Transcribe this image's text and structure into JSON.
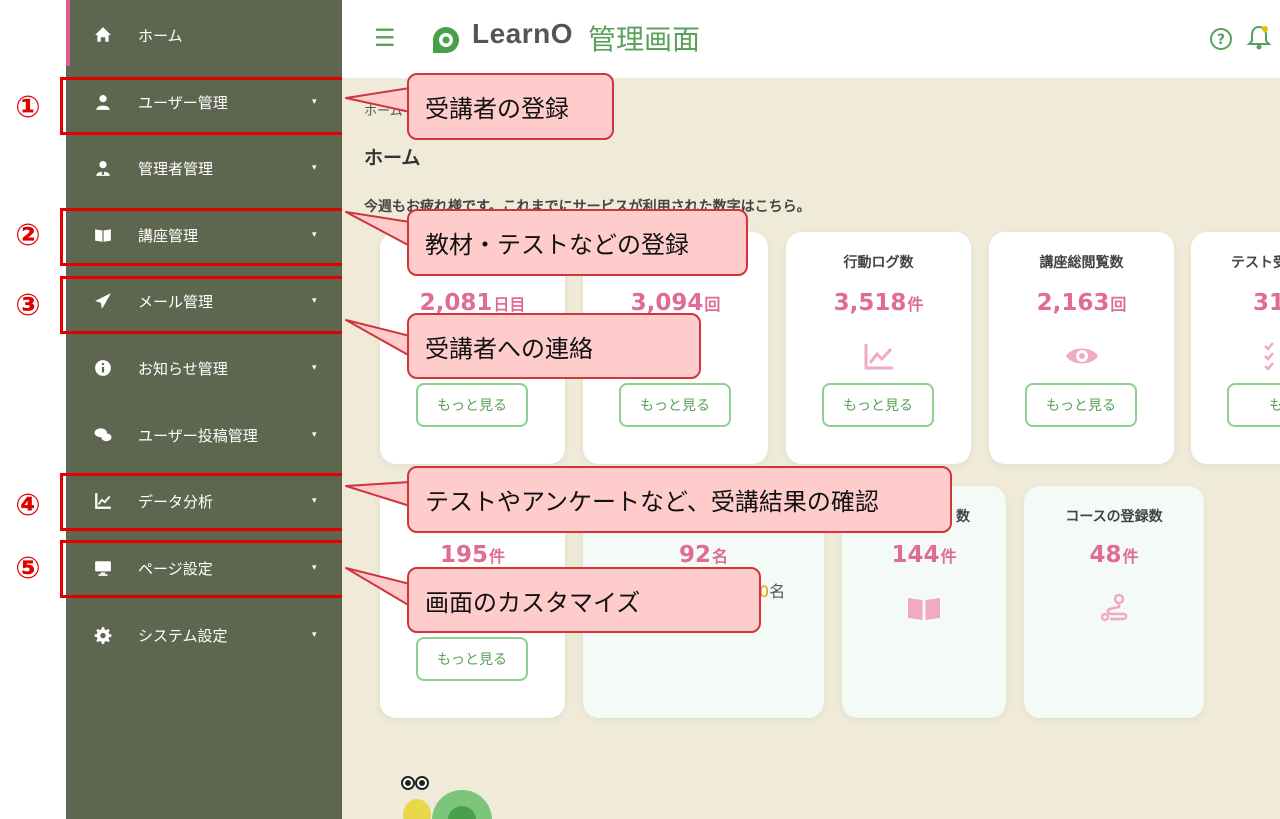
{
  "markers": [
    "①",
    "②",
    "③",
    "④",
    "⑤"
  ],
  "sidebar": {
    "items": [
      {
        "label": "ホーム",
        "icon": "home-icon"
      },
      {
        "label": "ユーザー管理",
        "icon": "user-icon"
      },
      {
        "label": "管理者管理",
        "icon": "admin-icon"
      },
      {
        "label": "講座管理",
        "icon": "book-icon"
      },
      {
        "label": "メール管理",
        "icon": "paper-plane-icon"
      },
      {
        "label": "お知らせ管理",
        "icon": "info-icon"
      },
      {
        "label": "ユーザー投稿管理",
        "icon": "comments-icon"
      },
      {
        "label": "データ分析",
        "icon": "chart-icon"
      },
      {
        "label": "ページ設定",
        "icon": "monitor-icon"
      },
      {
        "label": "システム設定",
        "icon": "gear-icon"
      }
    ]
  },
  "header": {
    "logo_text": "LearnO",
    "subtitle": "管理画面"
  },
  "breadcrumb": "ホーム",
  "page_title": "ホーム",
  "intro": "今週もお疲れ様です。これまでにサービスが利用された数字はこちら。",
  "cards_row1": [
    {
      "title": "",
      "value": "2,081",
      "unit": "日目"
    },
    {
      "title": "",
      "value": "3,094",
      "unit": "回"
    },
    {
      "title": "行動ログ数",
      "value": "3,518",
      "unit": "件"
    },
    {
      "title": "講座総閲覧数",
      "value": "2,163",
      "unit": "回"
    },
    {
      "title": "テスト受",
      "value": "31",
      "unit": ""
    }
  ],
  "cards_row2": [
    {
      "title": "",
      "value": "195",
      "unit": "件"
    },
    {
      "title": "",
      "value": "92",
      "unit": "名",
      "note": "0名"
    },
    {
      "title": "数",
      "value": "144",
      "unit": "件"
    },
    {
      "title": "コースの登録数",
      "value": "48",
      "unit": "件"
    }
  ],
  "more_label": "もっと見る",
  "more_label_cut": "もっ",
  "callouts": [
    "受講者の登録",
    "教材・テストなどの登録",
    "受講者への連絡",
    "テストやアンケートなど、受講結果の確認",
    "画面のカスタマイズ"
  ],
  "colors": {
    "sidebar": "#5f6650",
    "accent_pink": "#e06b95",
    "accent_green": "#5aa05a",
    "callout_bg": "#ffcccc",
    "frame_red": "#e00000"
  }
}
